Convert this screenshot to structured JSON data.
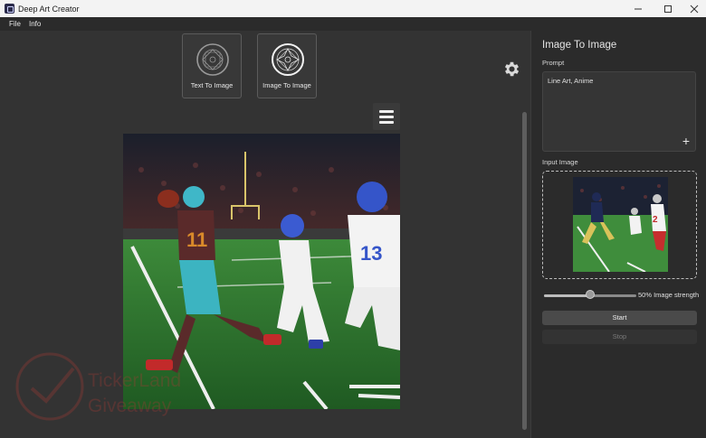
{
  "window": {
    "title": "Deep Art Creator"
  },
  "menu": [
    "File",
    "Info"
  ],
  "modes": [
    {
      "label": "Text To Image",
      "icon": "mandala-icon",
      "selected": false
    },
    {
      "label": "Image To Image",
      "icon": "mandala-icon",
      "selected": true
    }
  ],
  "panel": {
    "title": "Image To Image",
    "prompt_label": "Prompt",
    "prompt_value": "Line Art, Anime",
    "input_label": "Input Image",
    "strength": 0.5,
    "strength_text": "50% Image strength",
    "start_label": "Start",
    "stop_label": "Stop"
  },
  "watermark": {
    "line1": "TickerLand",
    "line2": "Giveaway"
  },
  "colors": {
    "accent": "#e6e6e6",
    "background": "#2b2b2b",
    "watermark": "#a53a36"
  }
}
